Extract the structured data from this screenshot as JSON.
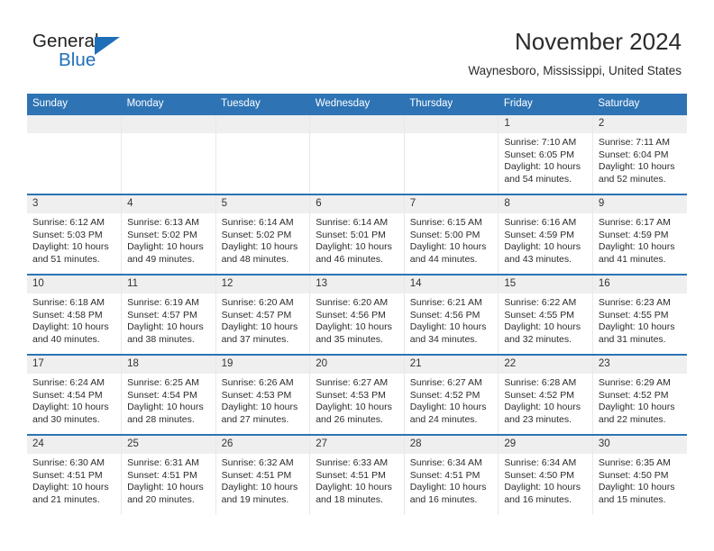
{
  "brand": {
    "name_part1": "General",
    "name_part2": "Blue",
    "accent_color": "#1f6fb8"
  },
  "header": {
    "title": "November 2024",
    "subtitle": "Waynesboro, Mississippi, United States",
    "header_bg": "#2e74b5",
    "daynum_bg": "#efefef"
  },
  "weekday_headers": [
    "Sunday",
    "Monday",
    "Tuesday",
    "Wednesday",
    "Thursday",
    "Friday",
    "Saturday"
  ],
  "labels": {
    "sunrise_prefix": "Sunrise:",
    "sunset_prefix": "Sunset:",
    "daylight_prefix": "Daylight:"
  },
  "weeks": [
    [
      {
        "day": "",
        "empty": true
      },
      {
        "day": "",
        "empty": true
      },
      {
        "day": "",
        "empty": true
      },
      {
        "day": "",
        "empty": true
      },
      {
        "day": "",
        "empty": true
      },
      {
        "day": "1",
        "sunrise": "Sunrise: 7:10 AM",
        "sunset": "Sunset: 6:05 PM",
        "daylight": "Daylight: 10 hours and 54 minutes."
      },
      {
        "day": "2",
        "sunrise": "Sunrise: 7:11 AM",
        "sunset": "Sunset: 6:04 PM",
        "daylight": "Daylight: 10 hours and 52 minutes."
      }
    ],
    [
      {
        "day": "3",
        "sunrise": "Sunrise: 6:12 AM",
        "sunset": "Sunset: 5:03 PM",
        "daylight": "Daylight: 10 hours and 51 minutes."
      },
      {
        "day": "4",
        "sunrise": "Sunrise: 6:13 AM",
        "sunset": "Sunset: 5:02 PM",
        "daylight": "Daylight: 10 hours and 49 minutes."
      },
      {
        "day": "5",
        "sunrise": "Sunrise: 6:14 AM",
        "sunset": "Sunset: 5:02 PM",
        "daylight": "Daylight: 10 hours and 48 minutes."
      },
      {
        "day": "6",
        "sunrise": "Sunrise: 6:14 AM",
        "sunset": "Sunset: 5:01 PM",
        "daylight": "Daylight: 10 hours and 46 minutes."
      },
      {
        "day": "7",
        "sunrise": "Sunrise: 6:15 AM",
        "sunset": "Sunset: 5:00 PM",
        "daylight": "Daylight: 10 hours and 44 minutes."
      },
      {
        "day": "8",
        "sunrise": "Sunrise: 6:16 AM",
        "sunset": "Sunset: 4:59 PM",
        "daylight": "Daylight: 10 hours and 43 minutes."
      },
      {
        "day": "9",
        "sunrise": "Sunrise: 6:17 AM",
        "sunset": "Sunset: 4:59 PM",
        "daylight": "Daylight: 10 hours and 41 minutes."
      }
    ],
    [
      {
        "day": "10",
        "sunrise": "Sunrise: 6:18 AM",
        "sunset": "Sunset: 4:58 PM",
        "daylight": "Daylight: 10 hours and 40 minutes."
      },
      {
        "day": "11",
        "sunrise": "Sunrise: 6:19 AM",
        "sunset": "Sunset: 4:57 PM",
        "daylight": "Daylight: 10 hours and 38 minutes."
      },
      {
        "day": "12",
        "sunrise": "Sunrise: 6:20 AM",
        "sunset": "Sunset: 4:57 PM",
        "daylight": "Daylight: 10 hours and 37 minutes."
      },
      {
        "day": "13",
        "sunrise": "Sunrise: 6:20 AM",
        "sunset": "Sunset: 4:56 PM",
        "daylight": "Daylight: 10 hours and 35 minutes."
      },
      {
        "day": "14",
        "sunrise": "Sunrise: 6:21 AM",
        "sunset": "Sunset: 4:56 PM",
        "daylight": "Daylight: 10 hours and 34 minutes."
      },
      {
        "day": "15",
        "sunrise": "Sunrise: 6:22 AM",
        "sunset": "Sunset: 4:55 PM",
        "daylight": "Daylight: 10 hours and 32 minutes."
      },
      {
        "day": "16",
        "sunrise": "Sunrise: 6:23 AM",
        "sunset": "Sunset: 4:55 PM",
        "daylight": "Daylight: 10 hours and 31 minutes."
      }
    ],
    [
      {
        "day": "17",
        "sunrise": "Sunrise: 6:24 AM",
        "sunset": "Sunset: 4:54 PM",
        "daylight": "Daylight: 10 hours and 30 minutes."
      },
      {
        "day": "18",
        "sunrise": "Sunrise: 6:25 AM",
        "sunset": "Sunset: 4:54 PM",
        "daylight": "Daylight: 10 hours and 28 minutes."
      },
      {
        "day": "19",
        "sunrise": "Sunrise: 6:26 AM",
        "sunset": "Sunset: 4:53 PM",
        "daylight": "Daylight: 10 hours and 27 minutes."
      },
      {
        "day": "20",
        "sunrise": "Sunrise: 6:27 AM",
        "sunset": "Sunset: 4:53 PM",
        "daylight": "Daylight: 10 hours and 26 minutes."
      },
      {
        "day": "21",
        "sunrise": "Sunrise: 6:27 AM",
        "sunset": "Sunset: 4:52 PM",
        "daylight": "Daylight: 10 hours and 24 minutes."
      },
      {
        "day": "22",
        "sunrise": "Sunrise: 6:28 AM",
        "sunset": "Sunset: 4:52 PM",
        "daylight": "Daylight: 10 hours and 23 minutes."
      },
      {
        "day": "23",
        "sunrise": "Sunrise: 6:29 AM",
        "sunset": "Sunset: 4:52 PM",
        "daylight": "Daylight: 10 hours and 22 minutes."
      }
    ],
    [
      {
        "day": "24",
        "sunrise": "Sunrise: 6:30 AM",
        "sunset": "Sunset: 4:51 PM",
        "daylight": "Daylight: 10 hours and 21 minutes."
      },
      {
        "day": "25",
        "sunrise": "Sunrise: 6:31 AM",
        "sunset": "Sunset: 4:51 PM",
        "daylight": "Daylight: 10 hours and 20 minutes."
      },
      {
        "day": "26",
        "sunrise": "Sunrise: 6:32 AM",
        "sunset": "Sunset: 4:51 PM",
        "daylight": "Daylight: 10 hours and 19 minutes."
      },
      {
        "day": "27",
        "sunrise": "Sunrise: 6:33 AM",
        "sunset": "Sunset: 4:51 PM",
        "daylight": "Daylight: 10 hours and 18 minutes."
      },
      {
        "day": "28",
        "sunrise": "Sunrise: 6:34 AM",
        "sunset": "Sunset: 4:51 PM",
        "daylight": "Daylight: 10 hours and 16 minutes."
      },
      {
        "day": "29",
        "sunrise": "Sunrise: 6:34 AM",
        "sunset": "Sunset: 4:50 PM",
        "daylight": "Daylight: 10 hours and 16 minutes."
      },
      {
        "day": "30",
        "sunrise": "Sunrise: 6:35 AM",
        "sunset": "Sunset: 4:50 PM",
        "daylight": "Daylight: 10 hours and 15 minutes."
      }
    ]
  ]
}
